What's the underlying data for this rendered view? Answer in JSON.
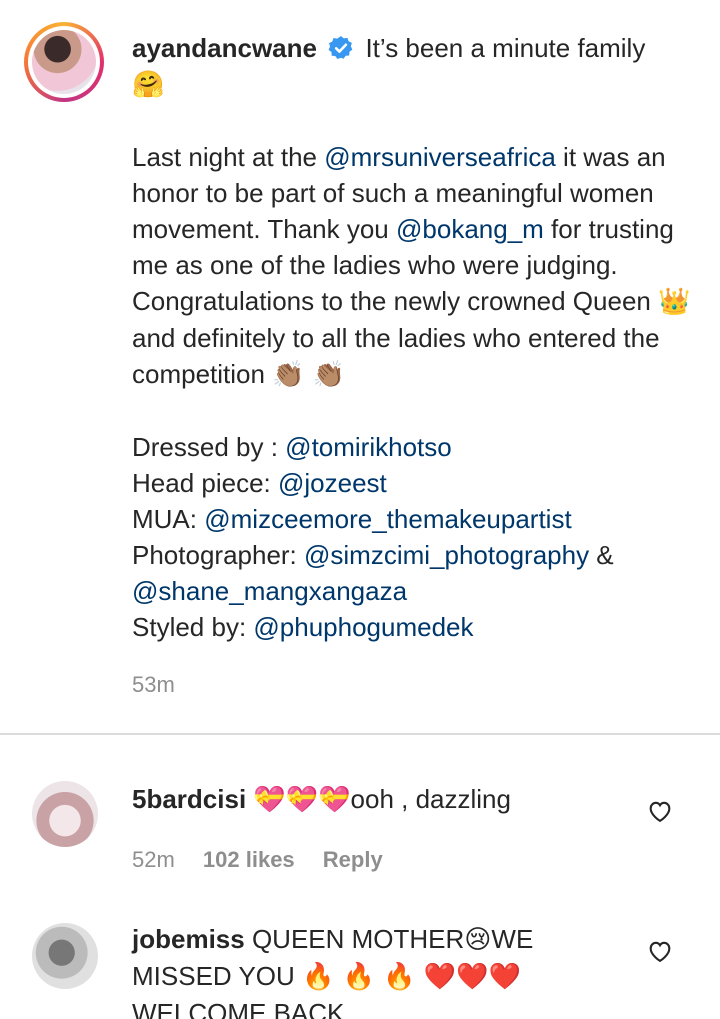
{
  "post": {
    "username": "ayandancwane",
    "verified_icon": "verified-badge-icon",
    "line1": "It’s been a minute family",
    "emoji1": "🤗",
    "p2_a": "Last night at the ",
    "mention1": "@mrsuniverseafrica",
    "p2_b": " it was an honor to be part of such a meaningful women movement. Thank you ",
    "mention2": "@bokang_m",
    "p2_c": " for trusting me as one of the ladies who were judging. Congratulations to the newly crowned Queen ",
    "emoji_crown": "👑",
    "p2_d": " and definitely to all the ladies who entered the competition ",
    "emoji_clap": "👏🏽 👏🏽",
    "credit1_label": "Dressed by : ",
    "credit1_mention": "@tomirikhotso",
    "credit2_label": "Head piece: ",
    "credit2_mention": "@jozeest",
    "credit3_label": "MUA: ",
    "credit3_mention": "@mizceemore_themakeupartist",
    "credit4_label": "Photographer: ",
    "credit4_mention": "@simzcimi_photography",
    "credit4_amp": " & ",
    "credit4_mention2": "@shane_mangxangaza",
    "credit5_label": "Styled by: ",
    "credit5_mention": "@phuphogumedek",
    "timestamp": "53m"
  },
  "comments": [
    {
      "username": "5bardcisi",
      "emoji": "💝💝💝",
      "text": "ooh , dazzling",
      "time": "52m",
      "likes": "102 likes",
      "reply": "Reply"
    },
    {
      "username": "jobemiss",
      "text_a": "QUEEN MOTHER",
      "emoji_a": "😢",
      "text_b": "WE MISSED YOU ",
      "emoji_b": "🔥 🔥 🔥 ❤️❤️❤️",
      "text_c": "WELCOME BACK"
    }
  ],
  "colors": {
    "mention": "#00376b",
    "meta": "#8e8e8e",
    "verified": "#3897f0"
  }
}
